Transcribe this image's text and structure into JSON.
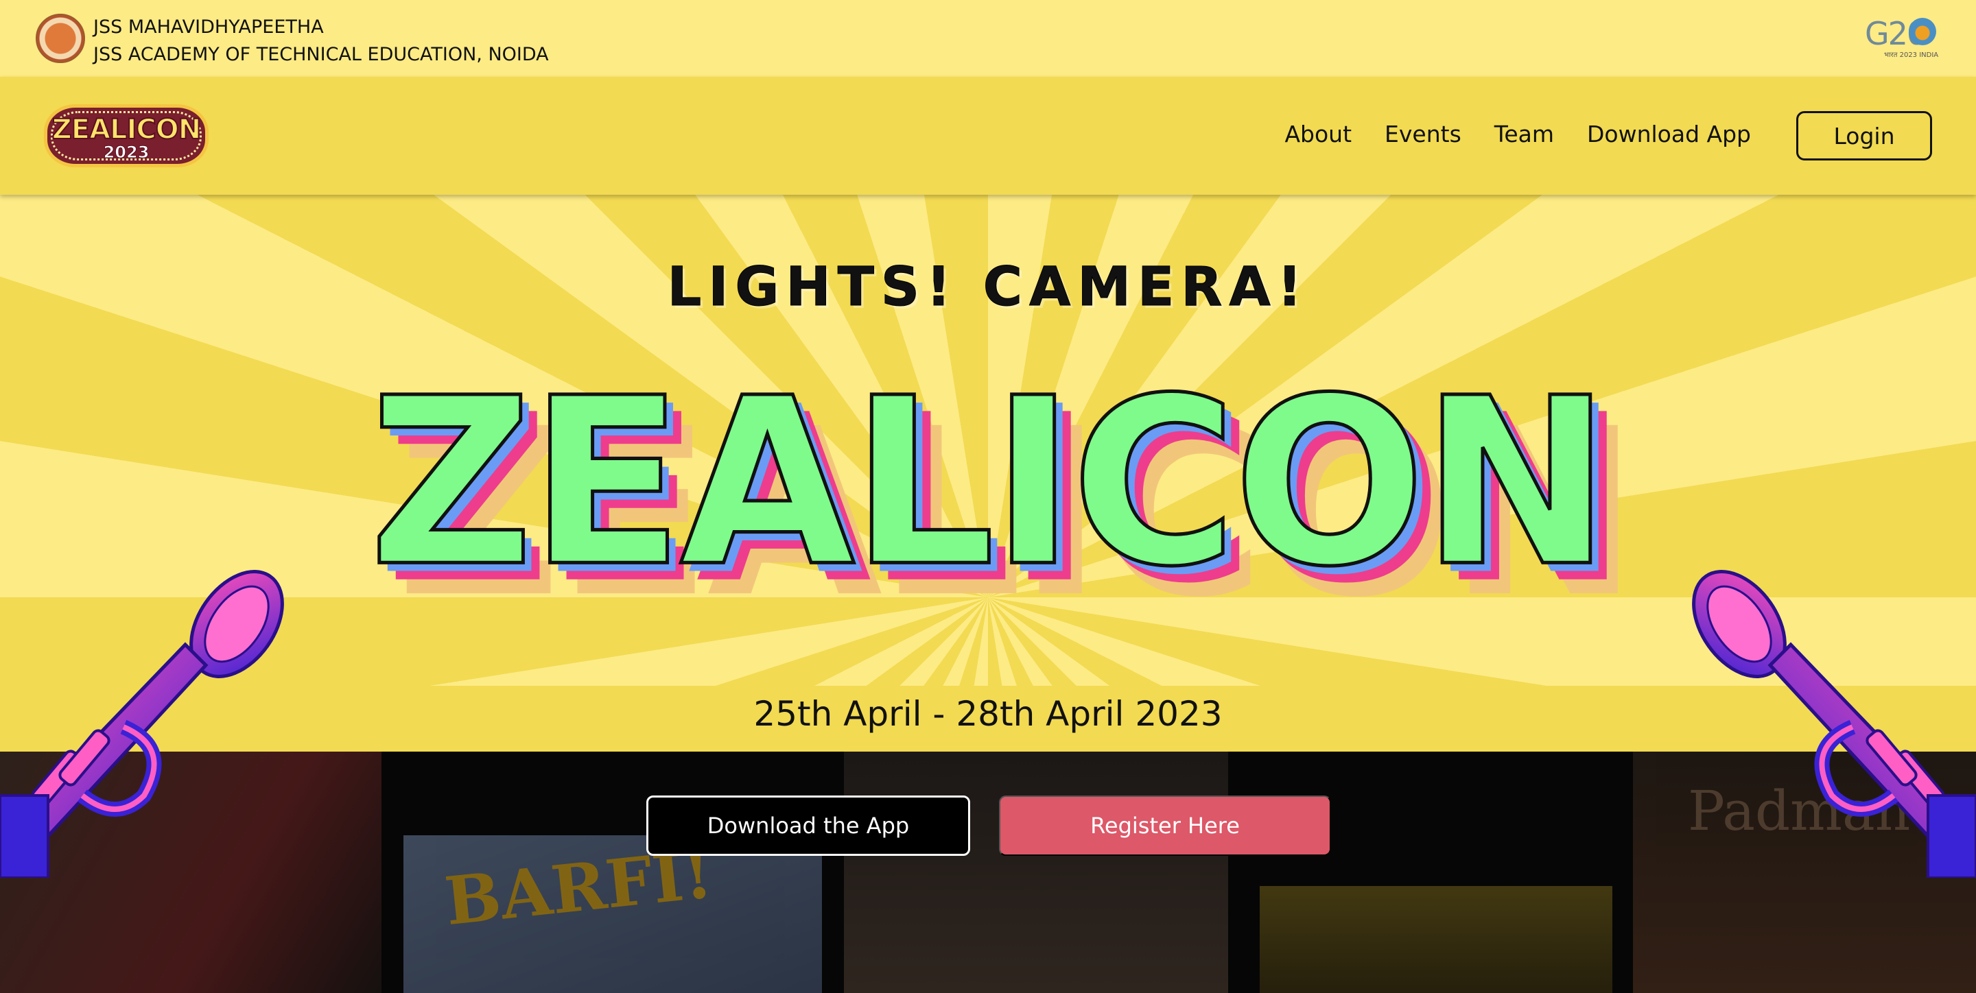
{
  "institute": {
    "line1": "JSS MAHAVIDHYAPEETHA",
    "line2": "JSS ACADEMY OF TECHNICAL EDUCATION, NOIDA",
    "g20_text": "G20",
    "g20_sub": "भारत 2023 INDIA"
  },
  "logo": {
    "word": "ZEALICON",
    "year": "2023"
  },
  "nav": {
    "links": [
      "About",
      "Events",
      "Team",
      "Download App"
    ],
    "login_label": "Login"
  },
  "hero": {
    "tagline": "LIGHTS! CAMERA!",
    "title": "ZEALICON",
    "dates": "25th April - 28th April 2023"
  },
  "cta": {
    "download_label": "Download the App",
    "register_label": "Register Here"
  },
  "posters": {
    "barfi": "BARFI!",
    "padman": "Padman"
  },
  "colors": {
    "topbar": "#fdeb85",
    "navbar": "#f2da52",
    "title_fill": "#7ffb8c",
    "shadow_blue": "#6a9cf5",
    "shadow_pink": "#ee3d8c",
    "shadow_tan": "#f1c67a",
    "register_button": "#dd5868",
    "trumpet": "#5b2bd9"
  }
}
